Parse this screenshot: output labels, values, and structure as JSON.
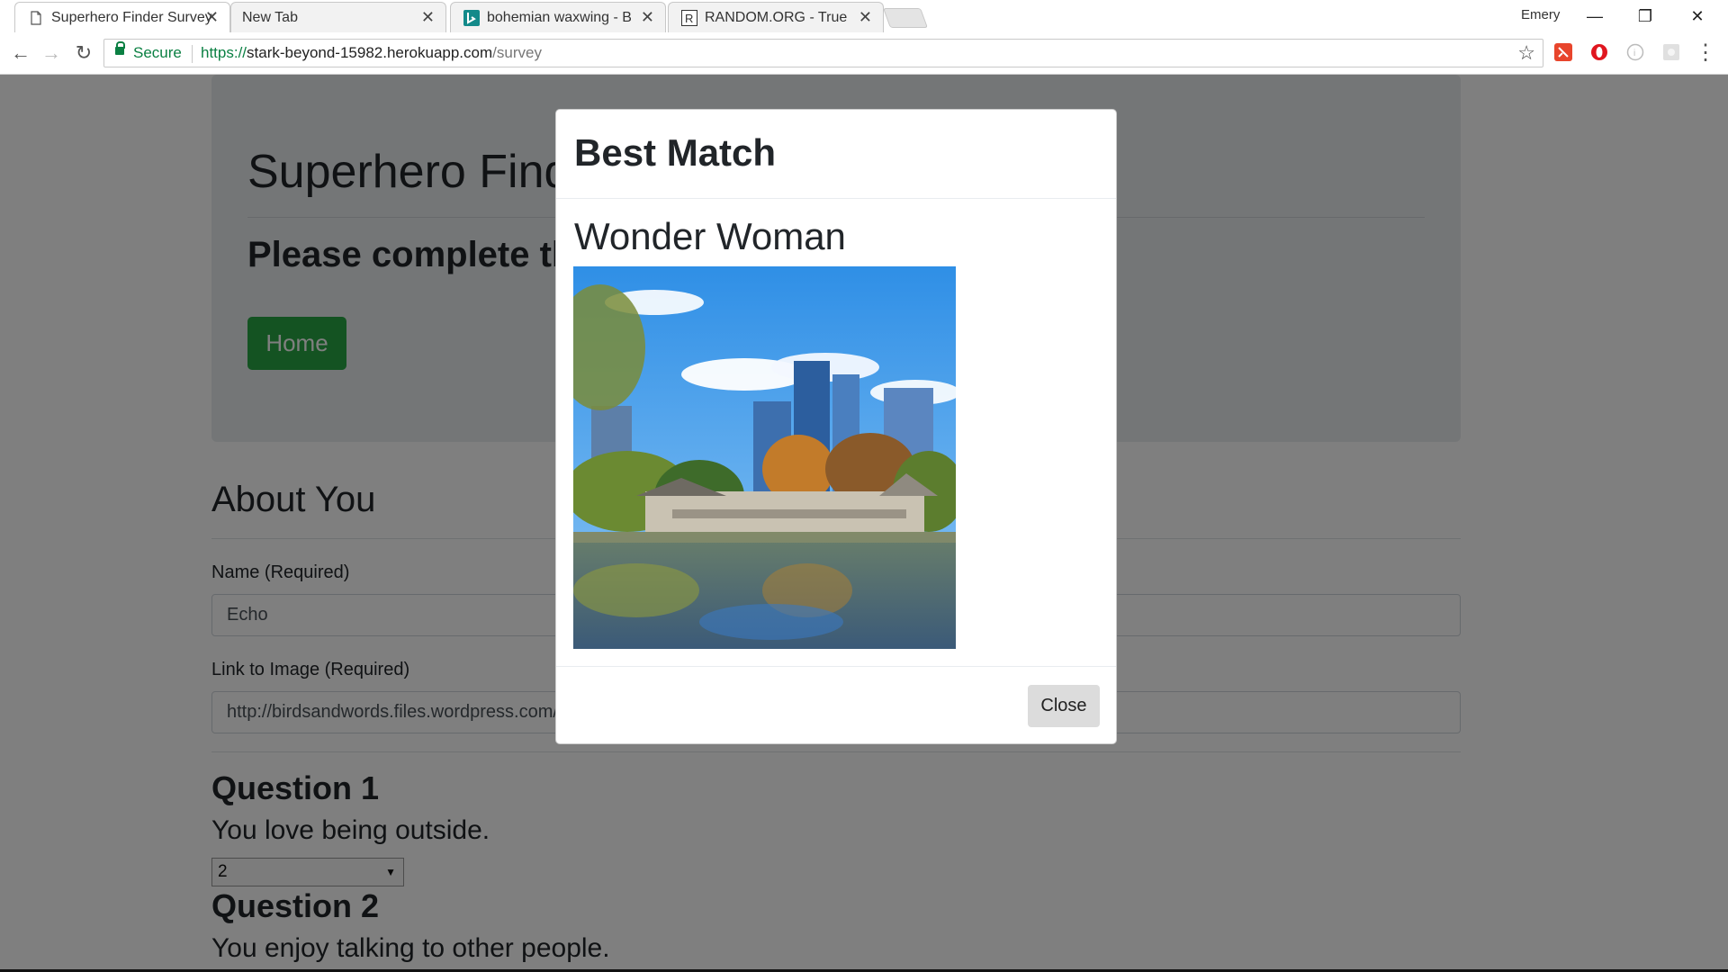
{
  "browser": {
    "tabs": [
      {
        "title": "Superhero Finder Survey",
        "active": true,
        "icon": "page-icon"
      },
      {
        "title": "New Tab",
        "active": false,
        "icon": ""
      },
      {
        "title": "bohemian waxwing - Bin",
        "active": false,
        "icon": "bing-icon"
      },
      {
        "title": "RANDOM.ORG - True Ra",
        "active": false,
        "icon": "random-org-icon"
      }
    ],
    "close_glyph": "✕",
    "user_name": "Emery",
    "window_controls": {
      "minimize": "—",
      "restore": "❐",
      "close": "✕"
    },
    "nav": {
      "back": "←",
      "forward": "→",
      "reload": "↻"
    },
    "security_label": "Secure",
    "url": {
      "scheme": "https://",
      "host": "stark-beyond-15982.herokuapp.com",
      "path": "/survey"
    },
    "bookmark_glyph": "☆",
    "menu_glyph": "⋮"
  },
  "page": {
    "title": "Superhero Finder Survey",
    "subtitle": "Please complete the survey",
    "home_label": "Home",
    "about_heading": "About You",
    "name_label": "Name (Required)",
    "name_value": "Echo",
    "image_label": "Link to Image (Required)",
    "image_value": "http://birdsandwords.files.wordpress.com/",
    "questions": [
      {
        "heading": "Question 1",
        "text": "You love being outside.",
        "selected": "2"
      },
      {
        "heading": "Question 2",
        "text": "You enjoy talking to other people."
      }
    ]
  },
  "modal": {
    "title": "Best Match",
    "match_name": "Wonder Woman",
    "close_label": "Close"
  }
}
